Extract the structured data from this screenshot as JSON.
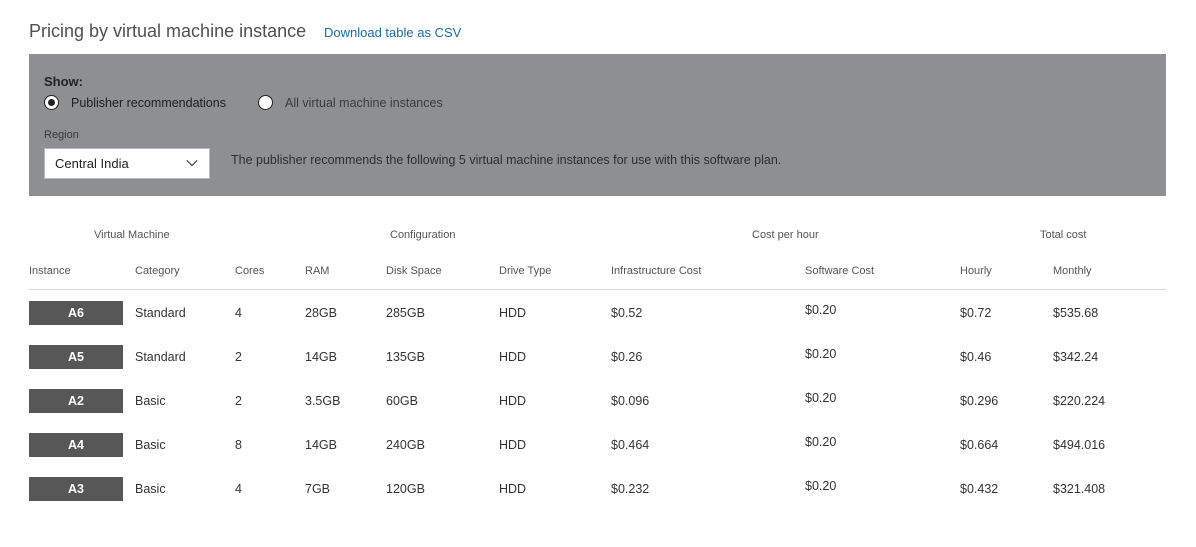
{
  "header": {
    "title": "Pricing by virtual machine instance",
    "download_link": "Download table as CSV"
  },
  "filter": {
    "show_label": "Show:",
    "options": [
      {
        "label": "Publisher recommendations",
        "selected": true
      },
      {
        "label": "All virtual machine instances",
        "selected": false
      }
    ],
    "region_label": "Region",
    "region_value": "Central India",
    "recommendation_text": "The publisher recommends the following 5 virtual machine instances for use with this software plan."
  },
  "table": {
    "group_headers": [
      "Virtual Machine",
      "Configuration",
      "Cost per hour",
      "Total cost"
    ],
    "columns": [
      "Instance",
      "Category",
      "Cores",
      "RAM",
      "Disk Space",
      "Drive Type",
      "Infrastructure Cost",
      "Software Cost",
      "Hourly",
      "Monthly"
    ],
    "rows": [
      {
        "instance": "A6",
        "category": "Standard",
        "cores": "4",
        "ram": "28GB",
        "disk": "285GB",
        "drive": "HDD",
        "infra_cost": "$0.52",
        "software_cost": "$0.20",
        "hourly": "$0.72",
        "monthly": "$535.68"
      },
      {
        "instance": "A5",
        "category": "Standard",
        "cores": "2",
        "ram": "14GB",
        "disk": "135GB",
        "drive": "HDD",
        "infra_cost": "$0.26",
        "software_cost": "$0.20",
        "hourly": "$0.46",
        "monthly": "$342.24"
      },
      {
        "instance": "A2",
        "category": "Basic",
        "cores": "2",
        "ram": "3.5GB",
        "disk": "60GB",
        "drive": "HDD",
        "infra_cost": "$0.096",
        "software_cost": "$0.20",
        "hourly": "$0.296",
        "monthly": "$220.224"
      },
      {
        "instance": "A4",
        "category": "Basic",
        "cores": "8",
        "ram": "14GB",
        "disk": "240GB",
        "drive": "HDD",
        "infra_cost": "$0.464",
        "software_cost": "$0.20",
        "hourly": "$0.664",
        "monthly": "$494.016"
      },
      {
        "instance": "A3",
        "category": "Basic",
        "cores": "4",
        "ram": "7GB",
        "disk": "120GB",
        "drive": "HDD",
        "infra_cost": "$0.232",
        "software_cost": "$0.20",
        "hourly": "$0.432",
        "monthly": "$321.408"
      }
    ]
  }
}
